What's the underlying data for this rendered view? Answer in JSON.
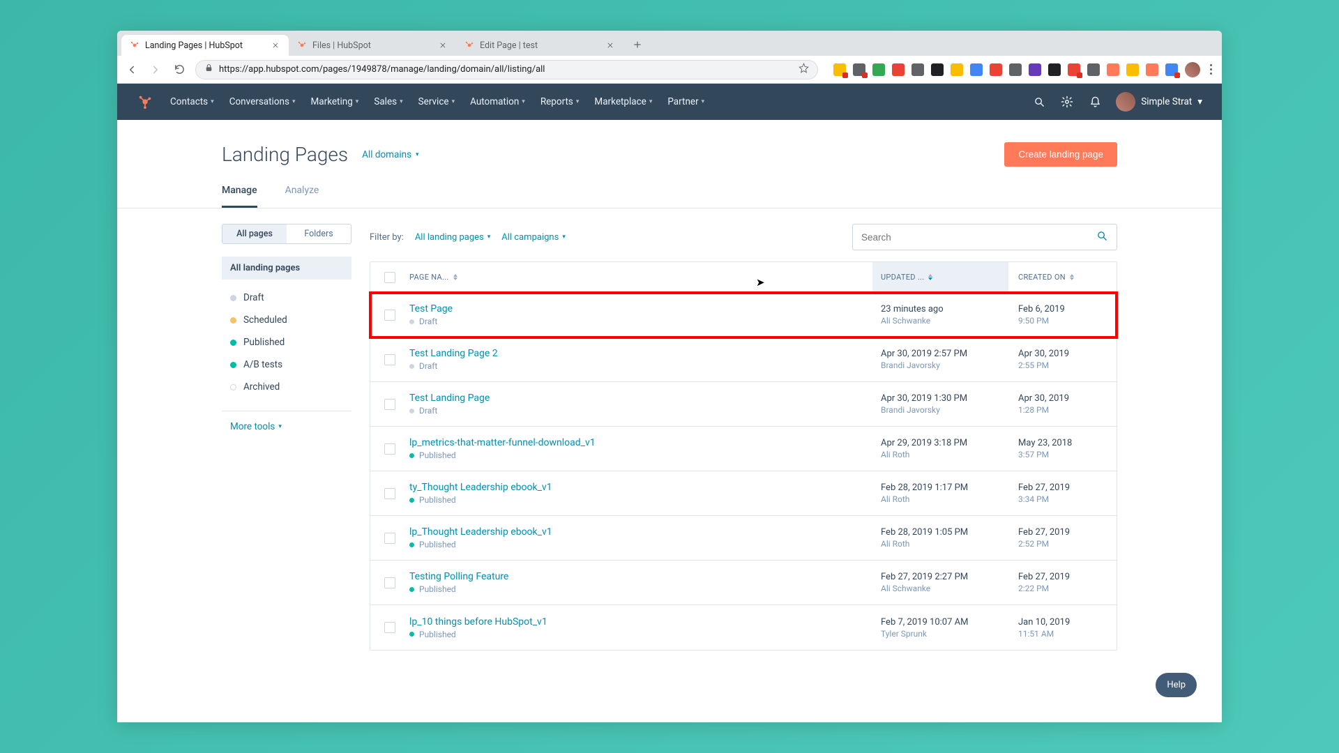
{
  "browser": {
    "tabs": [
      {
        "label": "Landing Pages | HubSpot",
        "active": true
      },
      {
        "label": "Files | HubSpot",
        "active": false
      },
      {
        "label": "Edit Page | test",
        "active": false
      }
    ],
    "url": "https://app.hubspot.com/pages/1949878/manage/landing/domain/all/listing/all"
  },
  "nav": {
    "menu": [
      "Contacts",
      "Conversations",
      "Marketing",
      "Sales",
      "Service",
      "Automation",
      "Reports",
      "Marketplace",
      "Partner"
    ],
    "account": "Simple Strat"
  },
  "header": {
    "title": "Landing Pages",
    "domain_selector": "All domains",
    "create_btn": "Create landing page"
  },
  "subtabs": {
    "manage": "Manage",
    "analyze": "Analyze"
  },
  "sidebar": {
    "seg_all": "All pages",
    "seg_folders": "Folders",
    "category_label": "All landing pages",
    "statuses": [
      {
        "label": "Draft",
        "color": "grey"
      },
      {
        "label": "Scheduled",
        "color": "orange"
      },
      {
        "label": "Published",
        "color": "green"
      },
      {
        "label": "A/B tests",
        "color": "green"
      },
      {
        "label": "Archived",
        "color": "hollow"
      }
    ],
    "more_tools": "More tools"
  },
  "filters": {
    "label": "Filter by:",
    "landing": "All landing pages",
    "campaigns": "All campaigns",
    "search_placeholder": "Search"
  },
  "table": {
    "columns": {
      "name": "PAGE NA...",
      "updated": "UPDATED ...",
      "created": "CREATED ON"
    },
    "rows": [
      {
        "name": "Test Page",
        "status": "Draft",
        "scolor": "grey",
        "updated_t": "23 minutes ago",
        "updated_by": "Ali Schwanke",
        "created_d": "Feb 6, 2019",
        "created_t": "9:50 PM",
        "highlight": true
      },
      {
        "name": "Test Landing Page 2",
        "status": "Draft",
        "scolor": "grey",
        "updated_t": "Apr 30, 2019 2:57 PM",
        "updated_by": "Brandi Javorsky",
        "created_d": "Apr 30, 2019",
        "created_t": "2:55 PM"
      },
      {
        "name": "Test Landing Page",
        "status": "Draft",
        "scolor": "grey",
        "updated_t": "Apr 30, 2019 1:30 PM",
        "updated_by": "Brandi Javorsky",
        "created_d": "Apr 30, 2019",
        "created_t": "1:28 PM"
      },
      {
        "name": "lp_metrics-that-matter-funnel-download_v1",
        "status": "Published",
        "scolor": "green",
        "updated_t": "Apr 29, 2019 3:18 PM",
        "updated_by": "Ali Roth",
        "created_d": "May 23, 2018",
        "created_t": "3:57 PM"
      },
      {
        "name": "ty_Thought Leadership ebook_v1",
        "status": "Published",
        "scolor": "green",
        "updated_t": "Feb 28, 2019 1:17 PM",
        "updated_by": "Ali Roth",
        "created_d": "Feb 27, 2019",
        "created_t": "3:34 PM"
      },
      {
        "name": "lp_Thought Leadership ebook_v1",
        "status": "Published",
        "scolor": "green",
        "updated_t": "Feb 28, 2019 1:05 PM",
        "updated_by": "Ali Roth",
        "created_d": "Feb 27, 2019",
        "created_t": "2:52 PM"
      },
      {
        "name": "Testing Polling Feature",
        "status": "Published",
        "scolor": "green",
        "updated_t": "Feb 27, 2019 2:27 PM",
        "updated_by": "Ali Schwanke",
        "created_d": "Feb 27, 2019",
        "created_t": "2:22 PM"
      },
      {
        "name": "lp_10 things before HubSpot_v1",
        "status": "Published",
        "scolor": "green",
        "updated_t": "Feb 7, 2019 10:07 AM",
        "updated_by": "Tyler Sprunk",
        "created_d": "Jan 10, 2019",
        "created_t": "11:51 AM"
      }
    ]
  },
  "help": "Help"
}
